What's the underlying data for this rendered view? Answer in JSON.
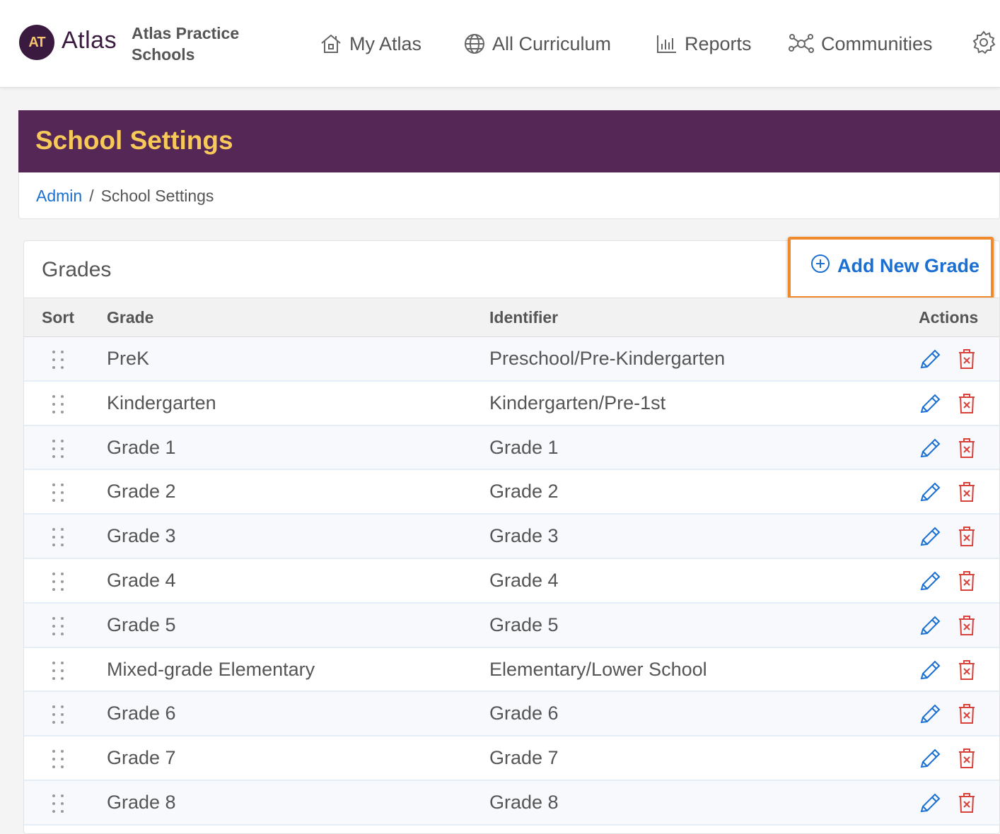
{
  "header": {
    "logo_badge": "AT",
    "logo_word": "Atlas",
    "school_name": "Atlas Practice Schools",
    "nav": [
      {
        "label": "My Atlas",
        "icon": "home-icon"
      },
      {
        "label": "All Curriculum",
        "icon": "globe-icon"
      },
      {
        "label": "Reports",
        "icon": "bar-chart-icon"
      },
      {
        "label": "Communities",
        "icon": "network-icon"
      }
    ],
    "settings_icon": "gear-icon"
  },
  "page": {
    "title": "School Settings",
    "breadcrumb": {
      "link": "Admin",
      "separator": "/",
      "current": "School Settings"
    }
  },
  "grades": {
    "title": "Grades",
    "add_button_label": "Add New Grade",
    "columns": {
      "sort": "Sort",
      "grade": "Grade",
      "identifier": "Identifier",
      "actions": "Actions"
    },
    "rows": [
      {
        "grade": "PreK",
        "identifier": "Preschool/Pre-Kindergarten"
      },
      {
        "grade": "Kindergarten",
        "identifier": "Kindergarten/Pre-1st"
      },
      {
        "grade": "Grade 1",
        "identifier": "Grade 1"
      },
      {
        "grade": "Grade 2",
        "identifier": "Grade 2"
      },
      {
        "grade": "Grade 3",
        "identifier": "Grade 3"
      },
      {
        "grade": "Grade 4",
        "identifier": "Grade 4"
      },
      {
        "grade": "Grade 5",
        "identifier": "Grade 5"
      },
      {
        "grade": "Mixed-grade Elementary",
        "identifier": "Elementary/Lower School"
      },
      {
        "grade": "Grade 6",
        "identifier": "Grade 6"
      },
      {
        "grade": "Grade 7",
        "identifier": "Grade 7"
      },
      {
        "grade": "Grade 8",
        "identifier": "Grade 8"
      }
    ]
  },
  "colors": {
    "brand_purple": "#552756",
    "title_gold": "#f6c95a",
    "link_blue": "#1a6fd1",
    "delete_red": "#d9413b",
    "highlight_orange": "#f08a2c"
  }
}
